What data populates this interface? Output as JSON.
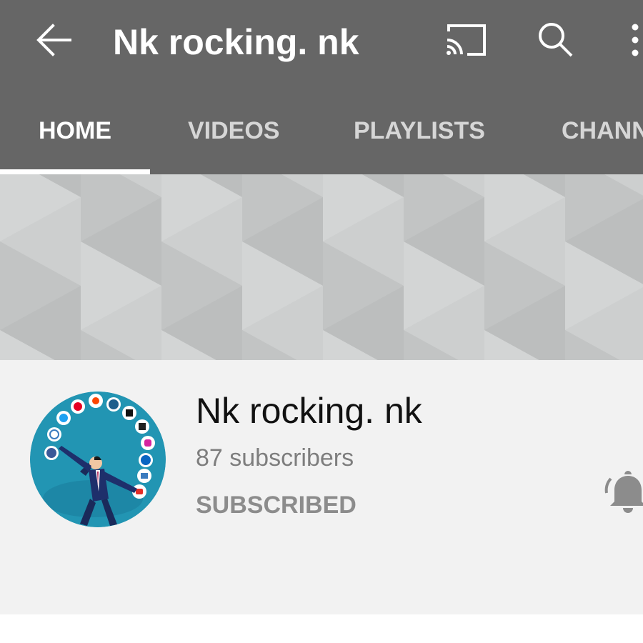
{
  "header": {
    "title": "Nk rocking. nk",
    "back_icon": "arrow-left-icon",
    "cast_icon": "cast-icon",
    "search_icon": "search-icon",
    "more_icon": "more-vertical-icon"
  },
  "tabs": [
    {
      "label": "HOME",
      "active": true
    },
    {
      "label": "VIDEOS",
      "active": false
    },
    {
      "label": "PLAYLISTS",
      "active": false
    },
    {
      "label": "CHANNELS",
      "active": false
    }
  ],
  "channel": {
    "name": "Nk rocking. nk",
    "subscribers": "87 subscribers",
    "subscribe_status": "SUBSCRIBED",
    "bell_icon": "notification-bell-icon",
    "avatar": "businessman-juggling-social-media-icons"
  },
  "colors": {
    "app_bar": "#666666",
    "tab_inactive": "#d6d6d6",
    "panel_bg": "#f2f2f2",
    "avatar_bg": "#1e8fae"
  }
}
